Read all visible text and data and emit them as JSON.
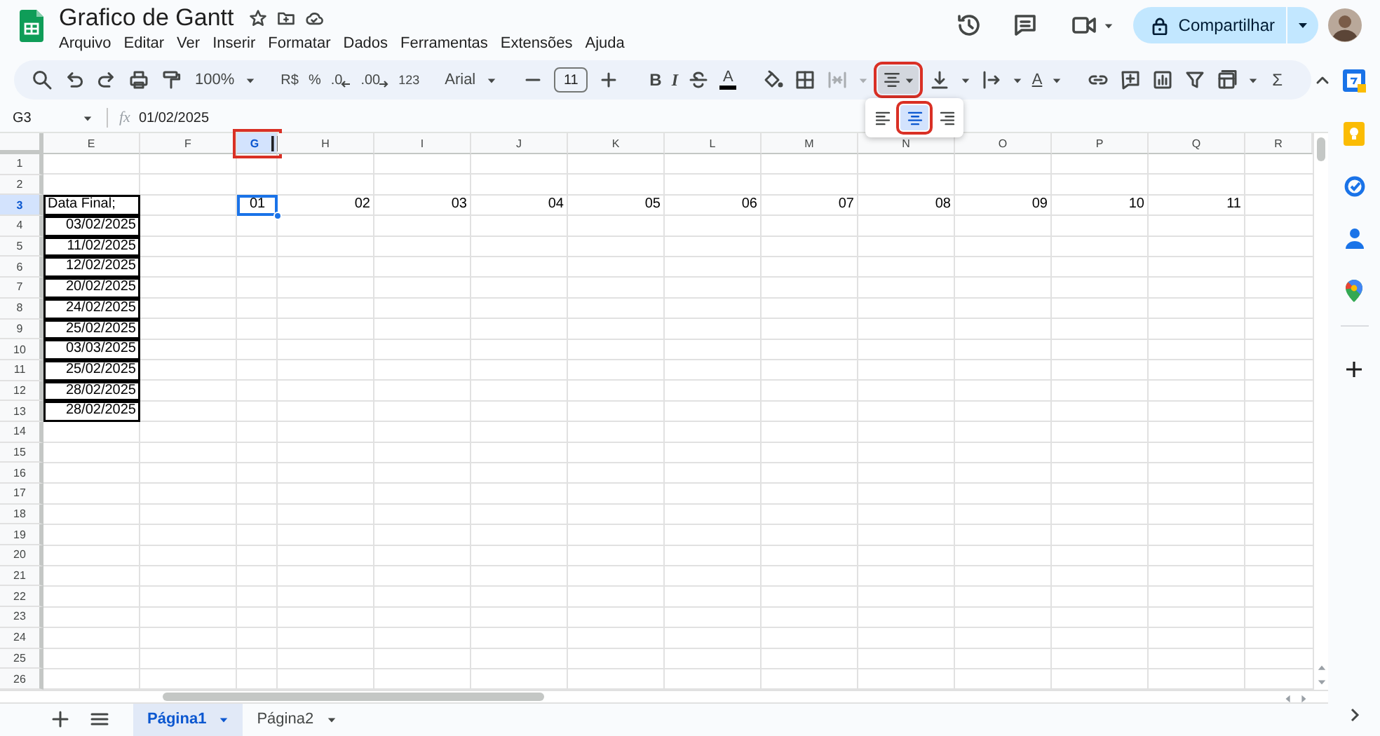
{
  "document": {
    "title": "Grafico de Gantt"
  },
  "menu": [
    "Arquivo",
    "Editar",
    "Ver",
    "Inserir",
    "Formatar",
    "Dados",
    "Ferramentas",
    "Extensões",
    "Ajuda"
  ],
  "share_button": {
    "label": "Compartilhar"
  },
  "toolbar": {
    "zoom": "100%",
    "currency": "R$",
    "percent": "%",
    "decrease_decimals": ".0",
    "increase_decimals": ".00",
    "number_format": "123",
    "font": "Arial",
    "font_size": "11",
    "bold": "B",
    "italic": "I",
    "text_color": "A",
    "text_rotation": "A",
    "functions": "Σ",
    "merge": {
      "disabled": true
    },
    "align": {
      "pressed": true,
      "highlighted": true
    }
  },
  "align_menu": {
    "options": [
      {
        "kind": "left",
        "selected": false,
        "highlighted": false
      },
      {
        "kind": "center",
        "selected": true,
        "highlighted": true
      },
      {
        "kind": "right",
        "selected": false,
        "highlighted": false
      }
    ]
  },
  "formula_bar": {
    "cell_reference": "G3",
    "fx": "fx",
    "value": "01/02/2025"
  },
  "columns": [
    {
      "label": "E",
      "selected": false,
      "highlighted": false,
      "resize_handle": false
    },
    {
      "label": "F",
      "selected": false,
      "highlighted": false,
      "resize_handle": false
    },
    {
      "label": "G",
      "selected": true,
      "highlighted": true,
      "resize_handle": true
    },
    {
      "label": "H",
      "selected": false,
      "highlighted": false,
      "resize_handle": false
    },
    {
      "label": "I",
      "selected": false,
      "highlighted": false,
      "resize_handle": false
    },
    {
      "label": "J",
      "selected": false,
      "highlighted": false,
      "resize_handle": false
    },
    {
      "label": "K",
      "selected": false,
      "highlighted": false,
      "resize_handle": false
    },
    {
      "label": "L",
      "selected": false,
      "highlighted": false,
      "resize_handle": false
    },
    {
      "label": "M",
      "selected": false,
      "highlighted": false,
      "resize_handle": false
    },
    {
      "label": "N",
      "selected": false,
      "highlighted": false,
      "resize_handle": false
    },
    {
      "label": "O",
      "selected": false,
      "highlighted": false,
      "resize_handle": false
    },
    {
      "label": "P",
      "selected": false,
      "highlighted": false,
      "resize_handle": false
    },
    {
      "label": "Q",
      "selected": false,
      "highlighted": false,
      "resize_handle": false
    },
    {
      "label": "R",
      "selected": false,
      "highlighted": false,
      "resize_handle": false
    }
  ],
  "rows": [
    {
      "header": "1",
      "selected": false
    },
    {
      "header": "2",
      "selected": false
    },
    {
      "header": "3",
      "selected": true,
      "cells": [
        {
          "text": "Data Final;",
          "kind": "left",
          "border": true,
          "selected": false
        },
        null,
        {
          "text": "01",
          "kind": "center",
          "border": false,
          "selected": true
        },
        {
          "text": "02",
          "kind": "right",
          "border": false,
          "selected": false
        },
        {
          "text": "03",
          "kind": "right",
          "border": false,
          "selected": false
        },
        {
          "text": "04",
          "kind": "right",
          "border": false,
          "selected": false
        },
        {
          "text": "05",
          "kind": "right",
          "border": false,
          "selected": false
        },
        {
          "text": "06",
          "kind": "right",
          "border": false,
          "selected": false
        },
        {
          "text": "07",
          "kind": "right",
          "border": false,
          "selected": false
        },
        {
          "text": "08",
          "kind": "right",
          "border": false,
          "selected": false
        },
        {
          "text": "09",
          "kind": "right",
          "border": false,
          "selected": false
        },
        {
          "text": "10",
          "kind": "right",
          "border": false,
          "selected": false
        },
        {
          "text": "11",
          "kind": "right",
          "border": false,
          "selected": false
        }
      ]
    },
    {
      "header": "4",
      "selected": false,
      "cells": [
        {
          "text": "03/02/2025",
          "kind": "right",
          "border": true,
          "selected": false
        }
      ]
    },
    {
      "header": "5",
      "selected": false,
      "cells": [
        {
          "text": "11/02/2025",
          "kind": "right",
          "border": true,
          "selected": false
        }
      ]
    },
    {
      "header": "6",
      "selected": false,
      "cells": [
        {
          "text": "12/02/2025",
          "kind": "right",
          "border": true,
          "selected": false
        }
      ]
    },
    {
      "header": "7",
      "selected": false,
      "cells": [
        {
          "text": "20/02/2025",
          "kind": "right",
          "border": true,
          "selected": false
        }
      ]
    },
    {
      "header": "8",
      "selected": false,
      "cells": [
        {
          "text": "24/02/2025",
          "kind": "right",
          "border": true,
          "selected": false
        }
      ]
    },
    {
      "header": "9",
      "selected": false,
      "cells": [
        {
          "text": "25/02/2025",
          "kind": "right",
          "border": true,
          "selected": false
        }
      ]
    },
    {
      "header": "10",
      "selected": false,
      "cells": [
        {
          "text": "03/03/2025",
          "kind": "right",
          "border": true,
          "selected": false
        }
      ]
    },
    {
      "header": "11",
      "selected": false,
      "cells": [
        {
          "text": "25/02/2025",
          "kind": "right",
          "border": true,
          "selected": false
        }
      ]
    },
    {
      "header": "12",
      "selected": false,
      "cells": [
        {
          "text": "28/02/2025",
          "kind": "right",
          "border": true,
          "selected": false
        }
      ]
    },
    {
      "header": "13",
      "selected": false,
      "cells": [
        {
          "text": "28/02/2025",
          "kind": "right",
          "border": true,
          "selected": false
        }
      ]
    },
    {
      "header": "14",
      "selected": false
    },
    {
      "header": "15",
      "selected": false
    },
    {
      "header": "16",
      "selected": false
    },
    {
      "header": "17",
      "selected": false
    },
    {
      "header": "18",
      "selected": false
    },
    {
      "header": "19",
      "selected": false
    },
    {
      "header": "20",
      "selected": false
    },
    {
      "header": "21",
      "selected": false
    },
    {
      "header": "22",
      "selected": false
    },
    {
      "header": "23",
      "selected": false
    },
    {
      "header": "24",
      "selected": false
    },
    {
      "header": "25",
      "selected": false
    },
    {
      "header": "26",
      "selected": false
    }
  ],
  "sheets": [
    {
      "label": "Página1",
      "selected": true
    },
    {
      "label": "Página2",
      "selected": false
    }
  ]
}
